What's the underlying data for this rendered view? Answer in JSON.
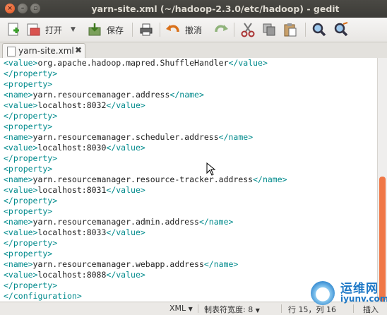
{
  "window": {
    "title": "yarn-site.xml (~/hadoop-2.3.0/etc/hadoop) - gedit"
  },
  "toolbar": {
    "open_label": "打开",
    "save_label": "保存",
    "undo_label": "撤消"
  },
  "tab": {
    "filename": "yarn-site.xml"
  },
  "editor": {
    "lines": [
      [
        {
          "t": "<value>",
          "c": "tag"
        },
        {
          "t": "org.apache.hadoop.mapred.ShuffleHandler",
          "c": "txt"
        },
        {
          "t": "</value>",
          "c": "tag"
        }
      ],
      [
        {
          "t": "</property>",
          "c": "tag"
        }
      ],
      [
        {
          "t": "<property>",
          "c": "tag"
        }
      ],
      [
        {
          "t": "<name>",
          "c": "tag"
        },
        {
          "t": "yarn.resourcemanager.address",
          "c": "txt"
        },
        {
          "t": "</name>",
          "c": "tag"
        }
      ],
      [
        {
          "t": "<value>",
          "c": "tag"
        },
        {
          "t": "localhost:8032",
          "c": "txt"
        },
        {
          "t": "</value>",
          "c": "tag"
        }
      ],
      [
        {
          "t": "</property>",
          "c": "tag"
        }
      ],
      [
        {
          "t": "<property>",
          "c": "tag"
        }
      ],
      [
        {
          "t": "<name>",
          "c": "tag"
        },
        {
          "t": "yarn.resourcemanager.scheduler.address",
          "c": "txt"
        },
        {
          "t": "</name>",
          "c": "tag"
        }
      ],
      [
        {
          "t": "<value>",
          "c": "tag"
        },
        {
          "t": "localhost:8030",
          "c": "txt"
        },
        {
          "t": "</value>",
          "c": "tag"
        }
      ],
      [
        {
          "t": "</property>",
          "c": "tag"
        }
      ],
      [
        {
          "t": "<property>",
          "c": "tag"
        }
      ],
      [
        {
          "t": "<name>",
          "c": "tag"
        },
        {
          "t": "yarn.resourcemanager.resource-tracker.address",
          "c": "txt"
        },
        {
          "t": "</name>",
          "c": "tag"
        }
      ],
      [
        {
          "t": "<value>",
          "c": "tag"
        },
        {
          "t": "localhost:8031",
          "c": "txt"
        },
        {
          "t": "</value>",
          "c": "tag"
        }
      ],
      [
        {
          "t": "</property>",
          "c": "tag"
        }
      ],
      [
        {
          "t": "<property>",
          "c": "tag"
        }
      ],
      [
        {
          "t": "<name>",
          "c": "tag"
        },
        {
          "t": "yarn.resourcemanager.admin.address",
          "c": "txt"
        },
        {
          "t": "</name>",
          "c": "tag"
        }
      ],
      [
        {
          "t": "<value>",
          "c": "tag"
        },
        {
          "t": "localhost:8033",
          "c": "txt"
        },
        {
          "t": "</value>",
          "c": "tag"
        }
      ],
      [
        {
          "t": "</property>",
          "c": "tag"
        }
      ],
      [
        {
          "t": "<property>",
          "c": "tag"
        }
      ],
      [
        {
          "t": "<name>",
          "c": "tag"
        },
        {
          "t": "yarn.resourcemanager.webapp.address",
          "c": "txt"
        },
        {
          "t": "</name>",
          "c": "tag"
        }
      ],
      [
        {
          "t": "<value>",
          "c": "tag"
        },
        {
          "t": "localhost:8088",
          "c": "txt"
        },
        {
          "t": "</value>",
          "c": "tag"
        }
      ],
      [
        {
          "t": "</property>",
          "c": "tag"
        }
      ],
      [
        {
          "t": "</configuration>",
          "c": "tag"
        }
      ]
    ]
  },
  "statusbar": {
    "language": "XML",
    "tab_width": "制表符宽度: 8",
    "position": "行 15，列 16",
    "mode": "插入"
  },
  "watermark": {
    "name": "运维网",
    "url": "iyunv.com"
  },
  "colors": {
    "tag": "#008a8c",
    "accent": "#f07746",
    "titlebar": "#3c3b37"
  }
}
